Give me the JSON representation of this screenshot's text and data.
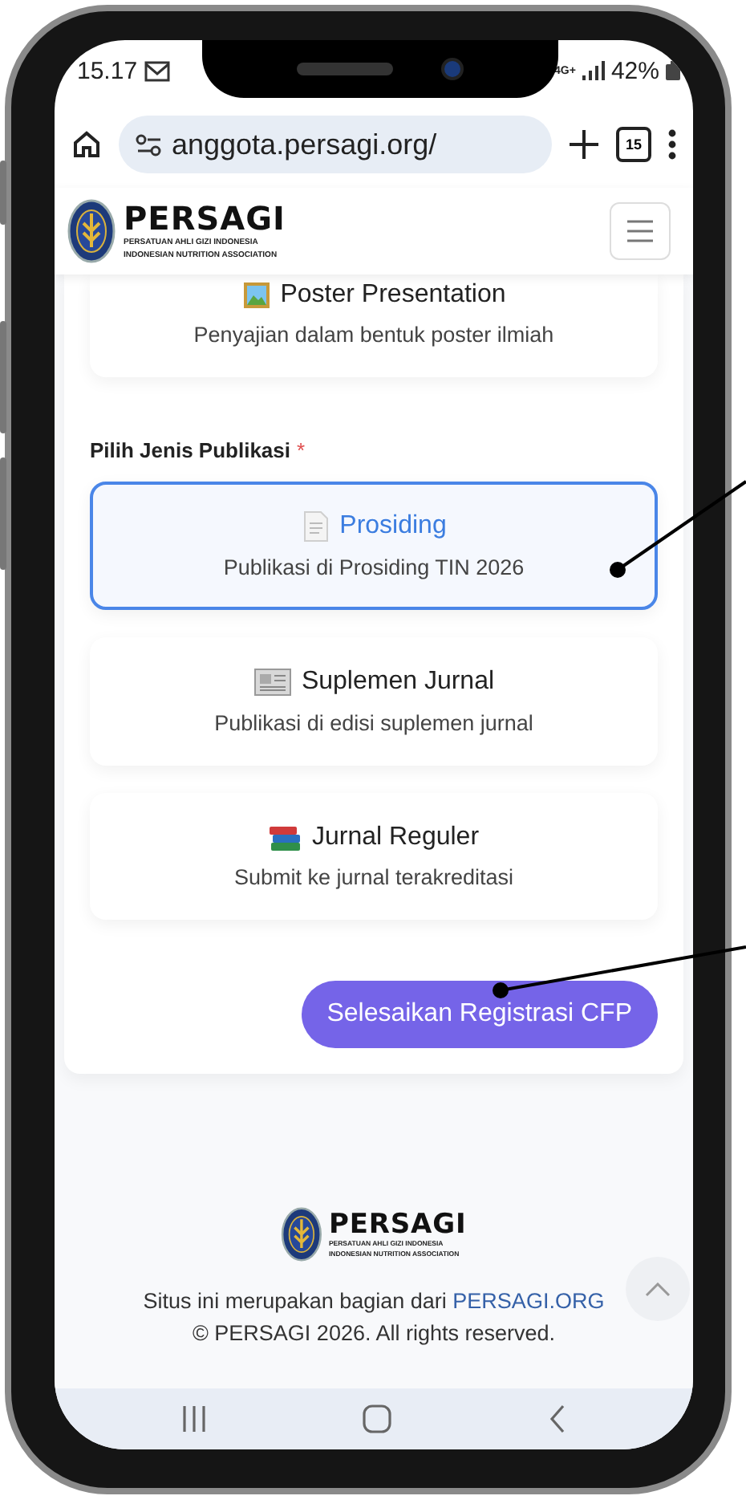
{
  "status_bar": {
    "time": "15.17",
    "network": "4G+",
    "battery": "42%"
  },
  "browser": {
    "url": "anggota.persagi.org/",
    "tab_count": "15"
  },
  "site_header": {
    "brand": "PERSAGI",
    "subtitle_1": "PERSATUAN AHLI GIZI INDONESIA",
    "subtitle_2": "INDONESIAN NUTRITION ASSOCIATION"
  },
  "presentation_option": {
    "kind": "picture",
    "title": "Poster Presentation",
    "description": "Penyajian dalam bentuk poster ilmiah"
  },
  "publication": {
    "label": "Pilih Jenis Publikasi",
    "required_mark": "*",
    "options": [
      {
        "kind": "document",
        "title": "Prosiding",
        "description": "Publikasi di Prosiding TIN 2026",
        "selected": true
      },
      {
        "kind": "newspaper",
        "title": "Suplemen Jurnal",
        "description": "Publikasi di edisi suplemen jurnal",
        "selected": false
      },
      {
        "kind": "books",
        "title": "Jurnal Reguler",
        "description": "Submit ke jurnal terakreditasi",
        "selected": false
      }
    ]
  },
  "submit_button": "Selesaikan Registrasi CFP",
  "footer": {
    "brand": "PERSAGI",
    "subtitle_1": "PERSATUAN AHLI GIZI INDONESIA",
    "subtitle_2": "INDONESIAN NUTRITION ASSOCIATION",
    "text": "Situs ini merupakan bagian dari",
    "link": "PERSAGI.ORG",
    "copyright": "© PERSAGI 2026. All rights reserved."
  }
}
